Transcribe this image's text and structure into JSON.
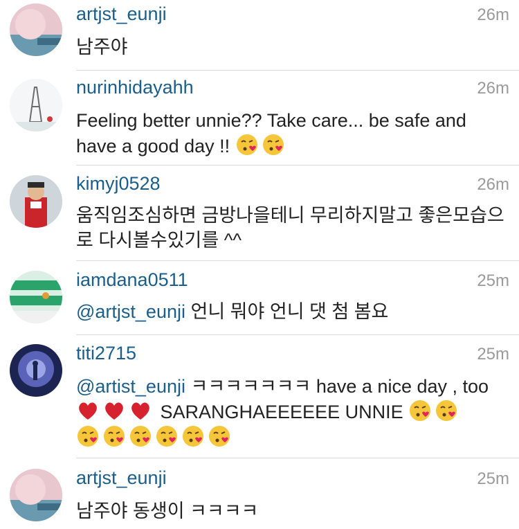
{
  "comments": [
    {
      "username": "artjst_eunji",
      "time": "26m",
      "text": "남주야"
    },
    {
      "username": "nurinhidayahh",
      "time": "26m",
      "text": "Feeling better unnie?? Take care... be safe and have a good day !!"
    },
    {
      "username": "kimyj0528",
      "time": "26m",
      "text": "움직임조심하면 금방나을테니 무리하지말고 좋은모습으",
      "text2": "로 다시볼수있기를 ^^"
    },
    {
      "username": "iamdana0511",
      "time": "25m",
      "mention": "@artjst_eunji",
      "text": " 언니 뭐야 언니 댓 첨 봄요"
    },
    {
      "username": "titi2715",
      "time": "25m",
      "mention": "@artist_eunji",
      "text": " ㅋㅋㅋㅋㅋㅋㅋ have a nice day , too",
      "text2": " SARANGHAEEEEEE UNNIE"
    },
    {
      "username": "artjst_eunji",
      "time": "25m",
      "text": "남주야 동생이 ㅋㅋㅋㅋ"
    }
  ],
  "colors": {
    "username": "#1a5e8c",
    "time": "#9a9a9a",
    "divider": "#dbdbdb"
  }
}
